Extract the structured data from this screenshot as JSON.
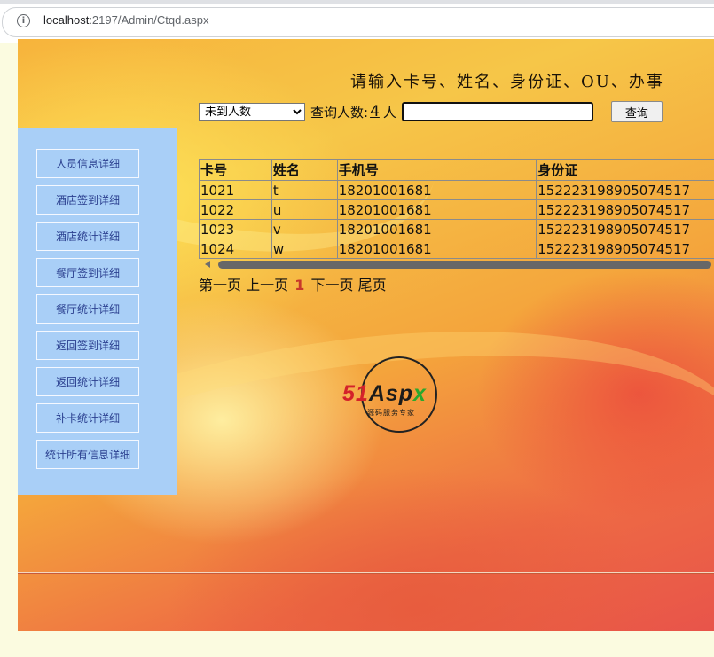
{
  "browser": {
    "url_host": "localhost",
    "url_rest": ":2197/Admin/Ctqd.aspx"
  },
  "prompt": "请输入卡号、姓名、身份证、OU、办事",
  "toolbar": {
    "select_value": "未到人数",
    "query_count_label": "查询人数:",
    "count": "4",
    "unit": "人",
    "search_value": "",
    "query_button": "查询"
  },
  "sidebar": {
    "items": [
      {
        "label": "人员信息详细"
      },
      {
        "label": "酒店签到详细"
      },
      {
        "label": "酒店统计详细"
      },
      {
        "label": "餐厅签到详细"
      },
      {
        "label": "餐厅统计详细"
      },
      {
        "label": "返回签到详细"
      },
      {
        "label": "返回统计详细"
      },
      {
        "label": "补卡统计详细"
      },
      {
        "label": "统计所有信息详细"
      }
    ]
  },
  "table": {
    "headers": [
      "卡号",
      "姓名",
      "手机号",
      "身份证"
    ],
    "rows": [
      [
        "1021",
        "t",
        "18201001681",
        "152223198905074517"
      ],
      [
        "1022",
        "u",
        "18201001681",
        "152223198905074517"
      ],
      [
        "1023",
        "v",
        "18201001681",
        "152223198905074517"
      ],
      [
        "1024",
        "w",
        "18201001681",
        "152223198905074517"
      ]
    ]
  },
  "pager": {
    "first": "第一页",
    "prev": "上一页",
    "current": "1",
    "next": "下一页",
    "last": "尾页"
  },
  "logo": {
    "brand_51": "51",
    "brand_asp": "Asp",
    "brand_x": "x",
    "tagline": "源码服务专家"
  },
  "colors": {
    "sidebar_bg": "#a9cff7",
    "nav_text": "#2a3f8f",
    "pager_current": "#c8372a"
  }
}
